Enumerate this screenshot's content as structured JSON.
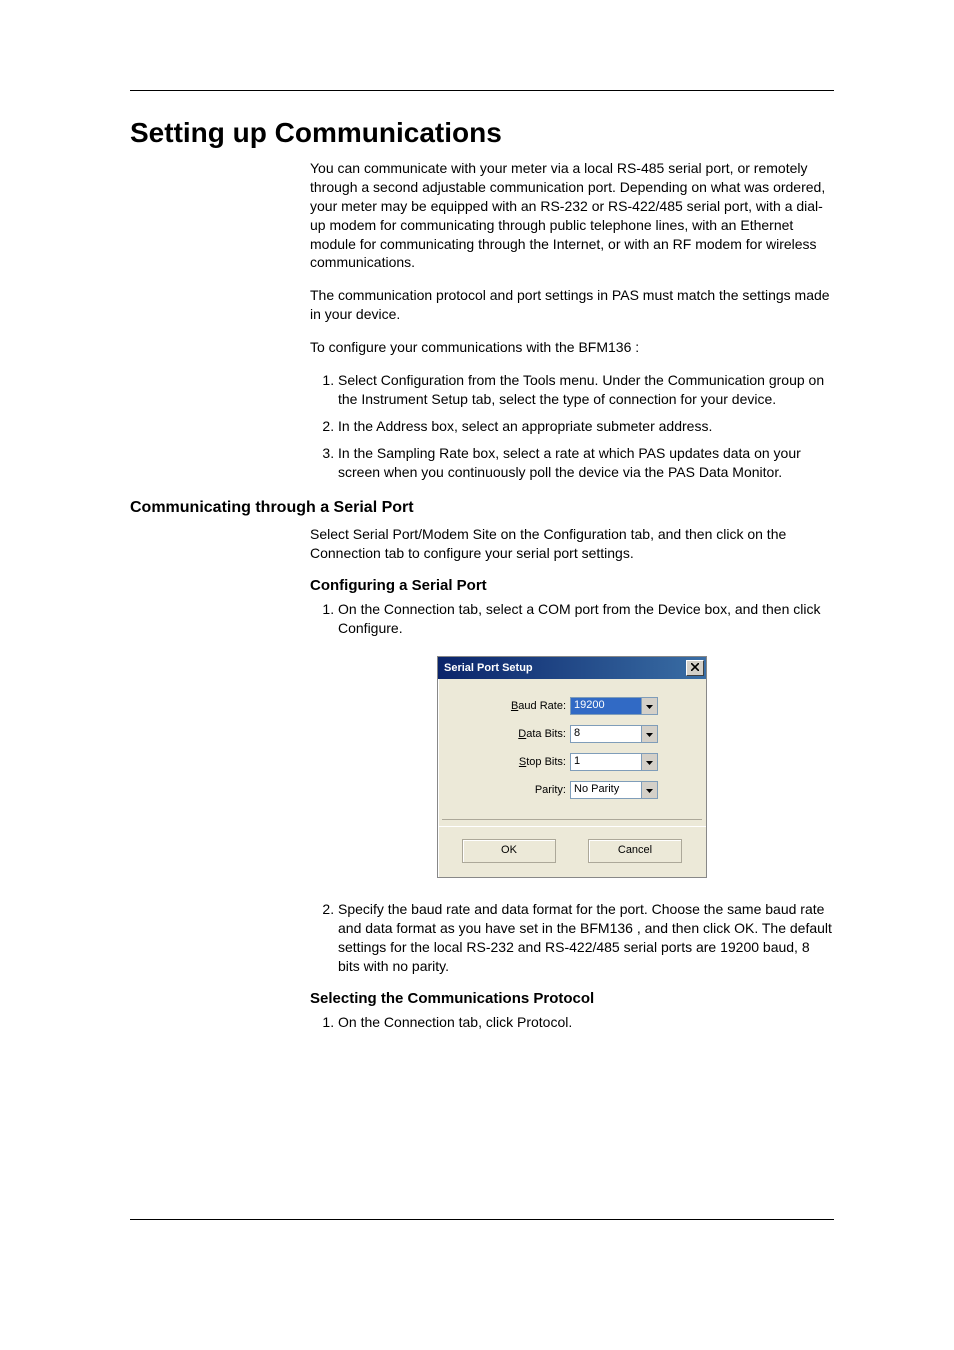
{
  "title": "Setting up Communications",
  "intro1": "You can communicate with your meter via a local RS-485 serial port, or remotely through a second adjustable communication port. Depending on what was ordered, your meter may be equipped with an RS-232 or RS-422/485 serial port, with a dial-up modem for communicating through public telephone lines, with an Ethernet module for communicating through the Internet, or with an RF modem for wireless communications.",
  "intro2": "The communication protocol and port settings in PAS must match the settings made in your device.",
  "intro3": "To configure your communications with the BFM136 :",
  "steps_main": [
    "Select Configuration from the Tools menu. Under the Communication group on the Instrument Setup tab, select the type of connection for your device.",
    "In the Address box, select an appropriate submeter address.",
    "In the Sampling Rate box, select a rate at which PAS updates data on your screen when you continuously poll the device via the PAS Data Monitor."
  ],
  "h2_serial": "Communicating through a Serial Port",
  "serial_intro": "Select Serial Port/Modem Site on the Configuration tab, and then click on the Connection tab to configure your serial port settings.",
  "h3_config": "Configuring a Serial Port",
  "config_step1": "On the Connection tab, select a COM port from the Device box, and then click Configure.",
  "dlg": {
    "title": "Serial Port Setup",
    "baud_label": "Baud Rate:",
    "baud_underline": "B",
    "baud_value": "19200",
    "data_label": "Data Bits:",
    "data_underline": "D",
    "data_value": "8",
    "stop_label": "Stop Bits:",
    "stop_underline": "S",
    "stop_value": "1",
    "parity_label": "Parity:",
    "parity_value": "No Parity",
    "ok": "OK",
    "cancel": "Cancel"
  },
  "config_step2": "Specify the baud rate and data format for the port. Choose the same baud rate and data format as you have set in the BFM136 , and then click OK. The default settings for the local RS-232 and RS-422/485 serial ports are 19200 baud, 8 bits with no parity.",
  "h3_protocol": "Selecting the Communications Protocol",
  "protocol_step1": "On the Connection tab, click Protocol."
}
